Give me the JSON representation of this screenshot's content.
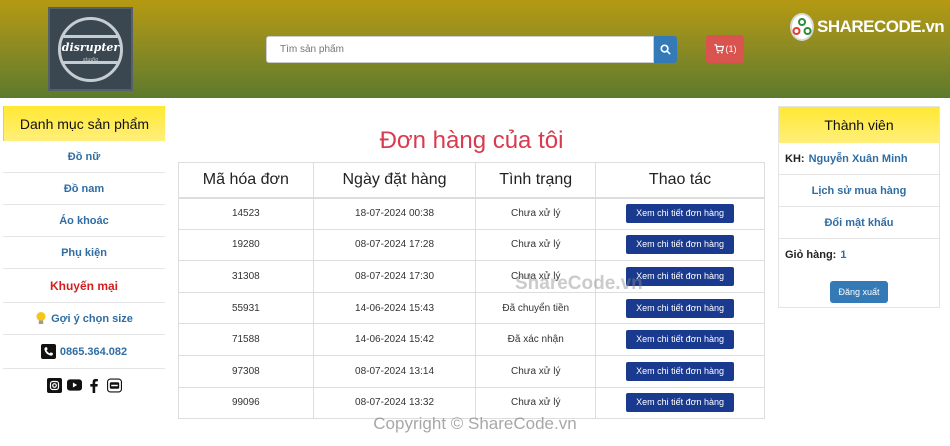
{
  "header": {
    "logo_text": "disrupter",
    "logo_sub": "studio",
    "search_placeholder": "Tìm sản phẩm",
    "cart_count": "(1)",
    "brand_part1": "SHARE",
    "brand_part2": "CODE.vn"
  },
  "sidebar_left": {
    "title": "Danh mục sản phẩm",
    "items": [
      {
        "label": "Đồ nữ"
      },
      {
        "label": "Đồ nam"
      },
      {
        "label": "Áo khoác"
      },
      {
        "label": "Phụ kiện"
      }
    ],
    "promo": "Khuyến mại",
    "size_hint": "Gợi ý chọn size",
    "phone": "0865.364.082"
  },
  "main": {
    "title": "Đơn hàng của tôi",
    "columns": [
      "Mã hóa đơn",
      "Ngày đặt hàng",
      "Tình trạng",
      "Thao tác"
    ],
    "action_label": "Xem chi tiết đơn hàng",
    "rows": [
      {
        "id": "14523",
        "date": "18-07-2024 00:38",
        "status": "Chưa xử lý"
      },
      {
        "id": "19280",
        "date": "08-07-2024 17:28",
        "status": "Chưa xử lý"
      },
      {
        "id": "31308",
        "date": "08-07-2024 17:30",
        "status": "Chưa xử lý"
      },
      {
        "id": "55931",
        "date": "14-06-2024 15:43",
        "status": "Đã chuyển tiền"
      },
      {
        "id": "71588",
        "date": "14-06-2024 15:42",
        "status": "Đã xác nhận"
      },
      {
        "id": "97308",
        "date": "08-07-2024 13:14",
        "status": "Chưa xử lý"
      },
      {
        "id": "99096",
        "date": "08-07-2024 13:32",
        "status": "Chưa xử lý"
      }
    ]
  },
  "sidebar_right": {
    "title": "Thành viên",
    "customer_label": "KH:",
    "customer_name": "Nguyễn Xuân Minh",
    "history": "Lịch sử mua hàng",
    "change_password": "Đổi mật khẩu",
    "cart_label": "Giỏ hàng:",
    "cart_value": "1",
    "logout": "Đăng xuất"
  },
  "watermark": "ShareCode.vn",
  "copyright": "Copyright © ShareCode.vn",
  "colors": {
    "accent_blue": "#337ab7",
    "button_navy": "#1a3a8f",
    "title_red": "#d93a4f",
    "promo_red": "#d41f1f",
    "side_header_yellow": "#ffe833"
  }
}
